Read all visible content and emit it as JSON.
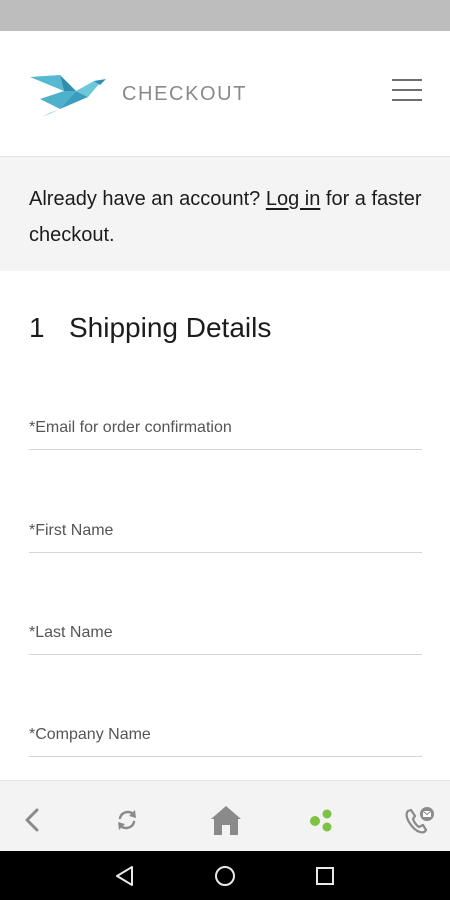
{
  "header": {
    "title": "CHECKOUT",
    "logo_icon": "bird-logo-icon",
    "menu_icon": "hamburger-menu-icon",
    "accent_color": "#3fa9c4"
  },
  "login_banner": {
    "text_before": "Already have an account? ",
    "link_text": "Log in",
    "text_after": " for a faster checkout."
  },
  "shipping": {
    "step_number": "1",
    "title": "Shipping Details",
    "fields": [
      {
        "label": "*Email for order confirmation",
        "value": ""
      },
      {
        "label": "*First Name",
        "value": ""
      },
      {
        "label": "*Last Name",
        "value": ""
      },
      {
        "label": "*Company Name",
        "value": ""
      }
    ]
  },
  "bottom_nav": {
    "items": [
      {
        "icon": "back-arrow-icon"
      },
      {
        "icon": "refresh-icon"
      },
      {
        "icon": "home-icon"
      },
      {
        "icon": "dots-cluster-icon",
        "color": "#7dc242"
      },
      {
        "icon": "phone-message-icon"
      }
    ]
  },
  "system_nav": {
    "items": [
      {
        "icon": "android-back-icon"
      },
      {
        "icon": "android-home-icon"
      },
      {
        "icon": "android-recents-icon"
      }
    ]
  }
}
